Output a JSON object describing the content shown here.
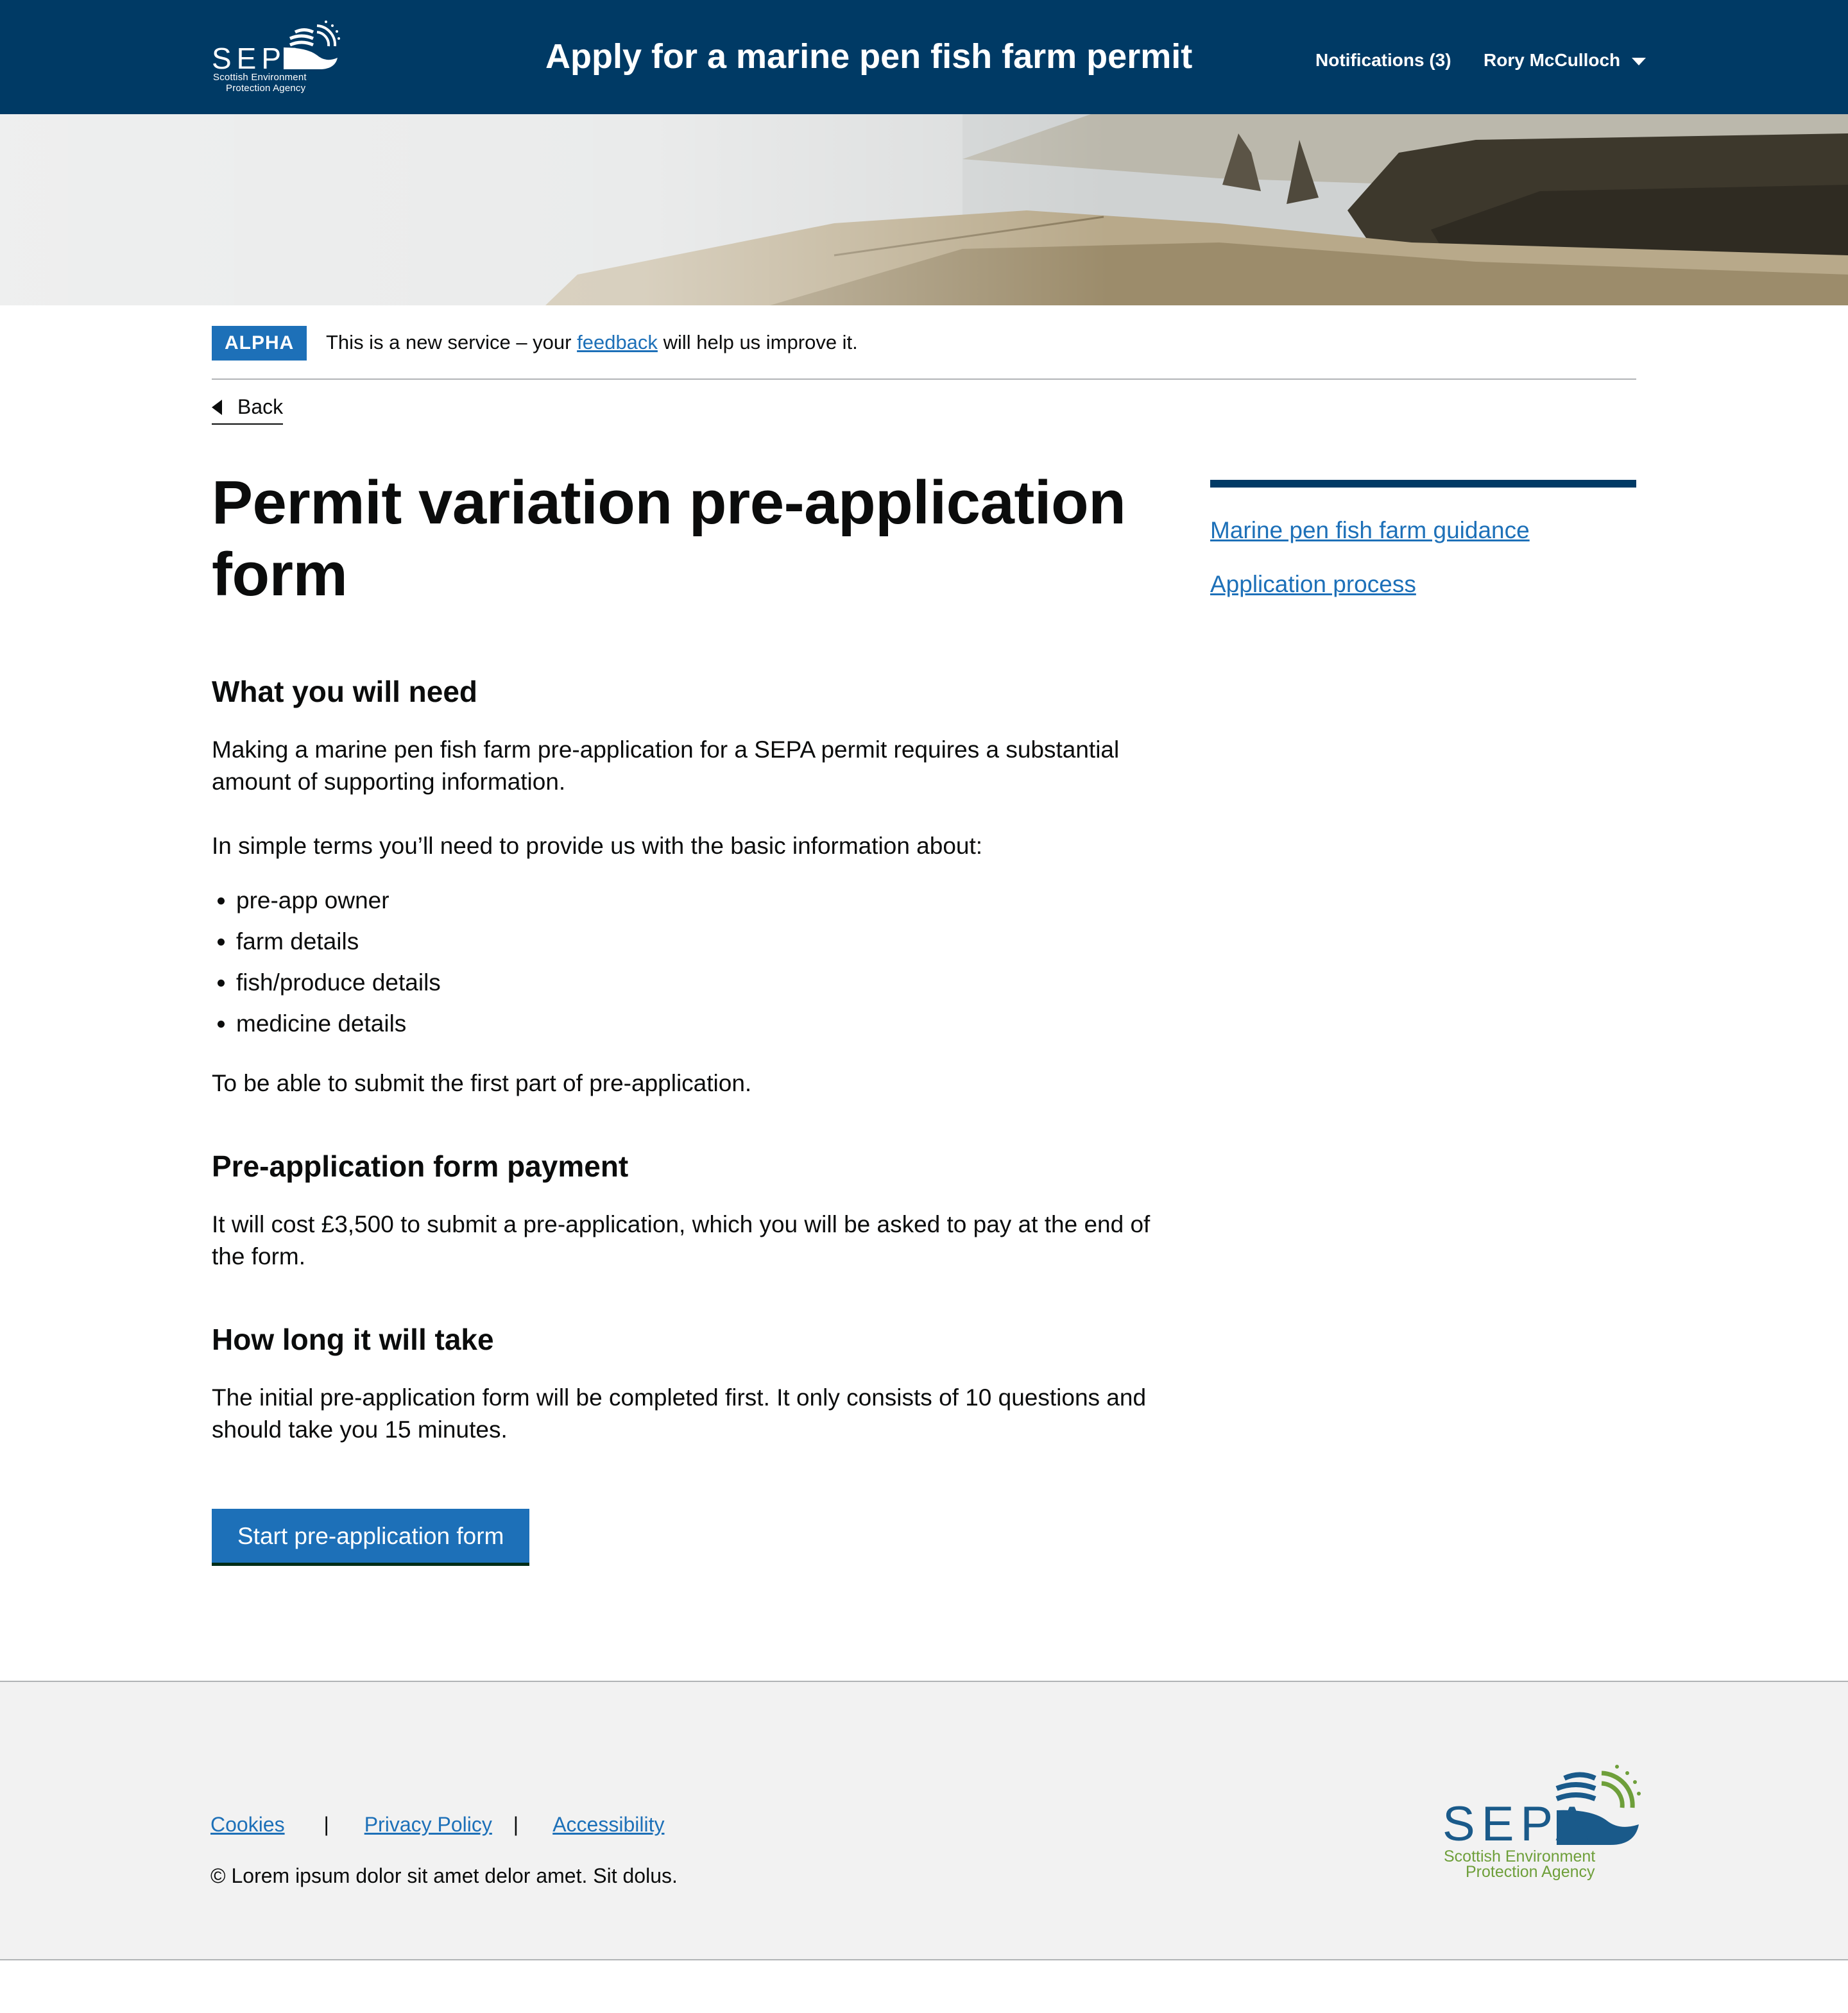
{
  "header": {
    "logo": {
      "word": "SEPA",
      "line1": "Scottish Environment",
      "line2": "Protection Agency"
    },
    "service_title": "Apply for a marine pen fish farm permit",
    "notifications": "Notifications (3)",
    "user_name": "Rory McCulloch"
  },
  "phase_banner": {
    "tag": "ALPHA",
    "text_before": "This is a new service – your",
    "link": "feedback",
    "text_after": "will help us improve it."
  },
  "back_link": "Back",
  "main": {
    "title_line1": "Permit variation pre-application",
    "title_line2": "form",
    "need_heading": "What you will need",
    "need_para1": "Making a marine pen fish farm pre-application for a SEPA permit requires a substantial amount of supporting information.",
    "need_para2": "In simple terms you’ll need to provide us with the basic information about:",
    "need_items": [
      "pre-app owner",
      "farm details",
      "fish/produce details",
      "medicine details"
    ],
    "need_para3": "To be able to submit the first part of pre-application.",
    "payment_heading": "Pre-application form payment",
    "payment_para": "It will cost £3,500 to submit a pre-application, which you will be asked to pay at the end of the form.",
    "time_heading": "How long it will take",
    "time_para": "The initial pre-application form will be completed first. It only consists of 10 questions and should take you 15 minutes.",
    "start_button": "Start pre-application form"
  },
  "side_nav": {
    "links": [
      "Marine pen fish farm guidance",
      "Application process"
    ]
  },
  "footer": {
    "links": [
      "Cookies",
      "Privacy Policy",
      "Accessibility"
    ],
    "separator": "|",
    "copyright": "© Lorem ipsum dolor sit amet delor amet. Sit dolus.",
    "logo": {
      "word": "SEPA",
      "line1": "Scottish Environment",
      "line2": "Protection Agency"
    }
  },
  "colors": {
    "header_bg": "#003a65",
    "link": "#1d70b8",
    "button": "#1d70b8",
    "footer_bg": "#f2f2f2",
    "logo_blue": "#1a5a8a",
    "logo_green": "#6e9f3a"
  },
  "icons": [
    "sepa-logo-icon",
    "chevron-down-icon",
    "back-arrow-icon"
  ]
}
